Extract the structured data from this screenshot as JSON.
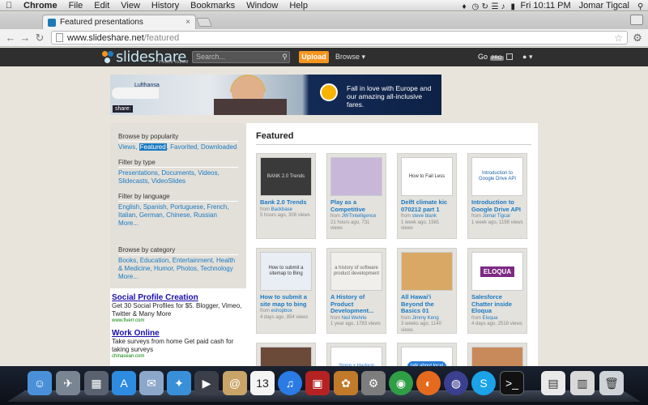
{
  "menubar": {
    "app_name": "Chrome",
    "items": [
      "File",
      "Edit",
      "View",
      "History",
      "Bookmarks",
      "Window",
      "Help"
    ],
    "clock": "Fri 10:11 PM",
    "user": "Jomar Tigcal"
  },
  "browser": {
    "tab_title": "Featured presentations",
    "url_host": "www.slideshare.net",
    "url_path": "/featured"
  },
  "slideshare": {
    "logo": "slideshare",
    "tagline": "Present Yourself",
    "search_placeholder": "Search...",
    "upload_label": "Upload",
    "browse_label": "Browse ▾",
    "go_label": "Go",
    "pro_label": "PRO",
    "user_label": "▾"
  },
  "banner": {
    "share_label": "share:",
    "brand": "Lufthansa",
    "ad_text": "Fall in love with Europe and our amazing all-inclusive fares."
  },
  "sidebar": {
    "popularity_heading": "Browse by popularity",
    "popularity_links": [
      "Views",
      "Featured",
      "Favorited",
      "Downloaded"
    ],
    "type_heading": "Filter by type",
    "type_links": [
      "Presentations",
      "Documents",
      "Videos",
      "Slidecasts",
      "VideoSlides"
    ],
    "language_heading": "Filter by language",
    "language_links": [
      "English",
      "Spanish",
      "Portuguese",
      "French",
      "Italian",
      "German",
      "Chinese",
      "Russian"
    ],
    "language_more": "More...",
    "category_heading": "Browse by category",
    "category_links": [
      "Books",
      "Education",
      "Entertainment",
      "Health & Medicine",
      "Humor",
      "Photos",
      "Technology"
    ],
    "category_more": "More..."
  },
  "ads": [
    {
      "title": "Social Profile Creation",
      "body": "Get 30 Social Profiles for $5. Blogger, Vimeo, Twitter & Many More",
      "url": "www.fiverr.com"
    },
    {
      "title": "Work Online",
      "body": "Take surveys from home Get paid cash for taking surveys",
      "url": "chinasean.com"
    }
  ],
  "featured": {
    "heading": "Featured",
    "cards": [
      {
        "title": "Bank 2.0 Trends",
        "author": "Backbase",
        "time": "5 hours ago",
        "views": "308 views",
        "thumb_text": "BANK 2.0 Trends"
      },
      {
        "title": "Play as a Competitive",
        "author": "JWTIntelligence",
        "time": "21 hours ago",
        "views": "731 views",
        "thumb_text": ""
      },
      {
        "title": "Delft climate kic 070212 part 1",
        "author": "steve blank",
        "time": "1 week ago",
        "views": "1581 views",
        "thumb_text": "How to Fail Less"
      },
      {
        "title": "Introduction to Google Drive API",
        "author": "Jomar Tigcal",
        "time": "1 week ago",
        "views": "1198 views",
        "thumb_text": "Introduction to Google Drive API"
      },
      {
        "title": "How to submit a site map to bing",
        "author": "eshopbox",
        "time": "4 days ago",
        "views": "854 views",
        "thumb_text": "How to submit a sitemap to Bing"
      },
      {
        "title": "A History of Product Development...",
        "author": "Neil Wehrle",
        "time": "1 year ago",
        "views": "1783 views",
        "thumb_text": "a history of software product development"
      },
      {
        "title": "All Hawai'i Beyond the Basics 01",
        "author": "Jimmy Keng",
        "time": "3 weeks ago",
        "views": "1140 views",
        "thumb_text": ""
      },
      {
        "title": "Salesforce Chatter inside Eloqua",
        "author": "Eloqua",
        "time": "4 days ago",
        "views": "2518 views",
        "thumb_text": "ELOQUA"
      },
      {
        "title": "",
        "author": "",
        "time": "",
        "views": "",
        "thumb_text": ""
      },
      {
        "title": "",
        "author": "",
        "time": "",
        "views": "",
        "thumb_text": "Storm + Hadoop"
      },
      {
        "title": "",
        "author": "",
        "time": "",
        "views": "",
        "thumb_text": "talk about local"
      },
      {
        "title": "",
        "author": "",
        "time": "",
        "views": "",
        "thumb_text": ""
      }
    ]
  },
  "dock": {
    "calendar_day": "13"
  },
  "colors": {
    "link": "#1b7ac2",
    "header": "#2f2f2f",
    "upload": "#f5951e",
    "ad_title": "#1a0dab"
  }
}
